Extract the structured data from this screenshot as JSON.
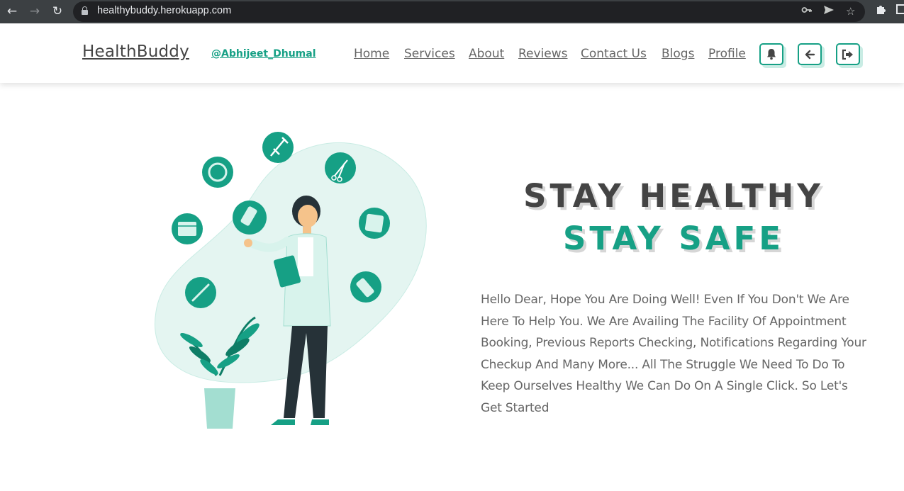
{
  "browser": {
    "url": "healthybuddy.herokuapp.com"
  },
  "header": {
    "brand": "HealthBuddy",
    "user_handle": "@Abhijeet_Dhumal",
    "nav": [
      "Home",
      "Services",
      "About",
      "Reviews",
      "Contact Us",
      "Blogs",
      "Profile"
    ],
    "icons": [
      "bell-icon",
      "arrow-left-icon",
      "sign-out-icon"
    ],
    "accent": "#16a085"
  },
  "hero": {
    "headline_1": "STAY HEALTHY",
    "headline_2": "STAY SAFE",
    "intro": "Hello Dear, Hope You Are Doing Well! Even If You Don't We Are Here To Help You. We Are Availing The Facility Of Appointment Booking, Previous Reports Checking, Notifications Regarding Your Checkup And Many More... All The Struggle We Need To Do To Keep Ourselves Healthy We Can Do On A Single Click. So Let's Get Started"
  }
}
